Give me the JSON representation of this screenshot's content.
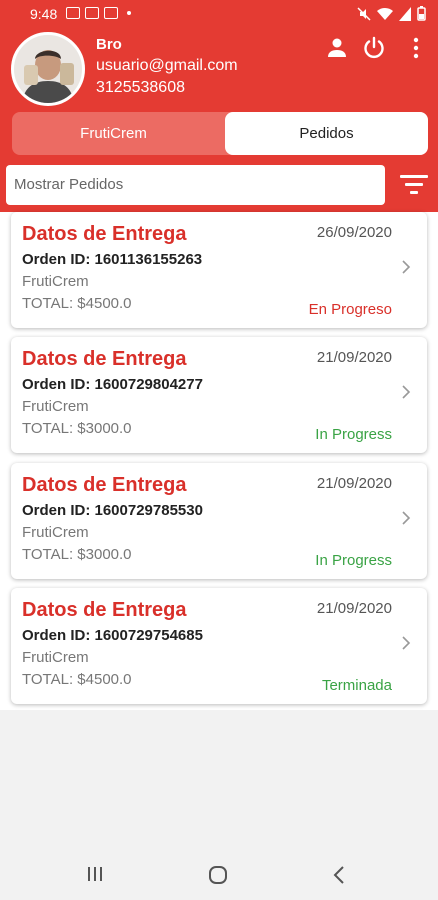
{
  "status_bar": {
    "time": "9:48"
  },
  "profile": {
    "name": "Bro",
    "email": "usuario@gmail.com",
    "phone": "3125538608"
  },
  "header_icons": [
    "person-icon",
    "power-icon",
    "more-vert-icon"
  ],
  "tabs": [
    {
      "label": "FrutiCrem",
      "selected": false
    },
    {
      "label": "Pedidos",
      "selected": true
    }
  ],
  "search": {
    "value": "Mostrar Pedidos"
  },
  "orders": [
    {
      "title": "Datos de Entrega",
      "date": "26/09/2020",
      "order_id": "Orden ID: 1601136155263",
      "shop": "FrutiCrem",
      "total": "TOTAL: $4500.0",
      "status": "En Progreso",
      "status_color": "#d9302a"
    },
    {
      "title": "Datos de Entrega",
      "date": "21/09/2020",
      "order_id": "Orden ID: 1600729804277",
      "shop": "FrutiCrem",
      "total": "TOTAL: $3000.0",
      "status": "In Progress",
      "status_color": "#3aa345"
    },
    {
      "title": "Datos de Entrega",
      "date": "21/09/2020",
      "order_id": "Orden ID: 1600729785530",
      "shop": "FrutiCrem",
      "total": "TOTAL: $3000.0",
      "status": "In Progress",
      "status_color": "#3aa345"
    },
    {
      "title": "Datos de Entrega",
      "date": "21/09/2020",
      "order_id": "Orden ID: 1600729754685",
      "shop": "FrutiCrem",
      "total": "TOTAL: $4500.0",
      "status": "Terminada",
      "status_color": "#3aa345"
    }
  ],
  "colors": {
    "primary": "#e43b33",
    "accent_red": "#d9302a",
    "green": "#3aa345"
  }
}
